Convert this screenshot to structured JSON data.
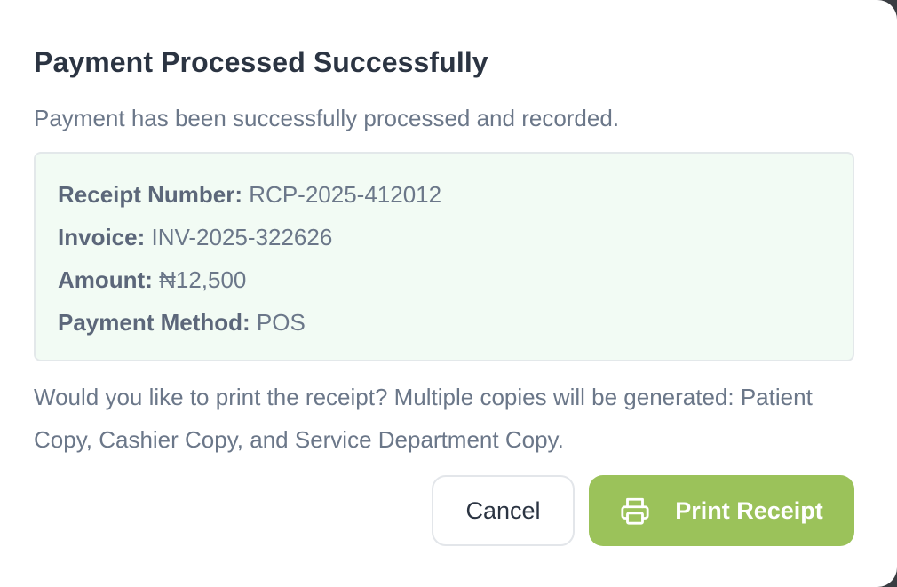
{
  "dialog": {
    "title": "Payment Processed Successfully",
    "subtitle": "Payment has been successfully processed and recorded."
  },
  "details": [
    {
      "label": "Receipt Number:",
      "value": "RCP-2025-412012"
    },
    {
      "label": "Invoice:",
      "value": "INV-2025-322626"
    },
    {
      "label": "Amount:",
      "value": "₦12,500"
    },
    {
      "label": "Payment Method:",
      "value": "POS"
    }
  ],
  "note": "Would you like to print the receipt? Multiple copies will be generated: Patient Copy, Cashier Copy, and Service Department Copy.",
  "buttons": {
    "cancel_label": "Cancel",
    "print_label": "Print Receipt",
    "print_icon": "printer-icon"
  },
  "colors": {
    "accent": "#9bc25a",
    "info_bg": "#f2fbf4",
    "title": "#2b3442",
    "muted_text": "#6b7789"
  }
}
